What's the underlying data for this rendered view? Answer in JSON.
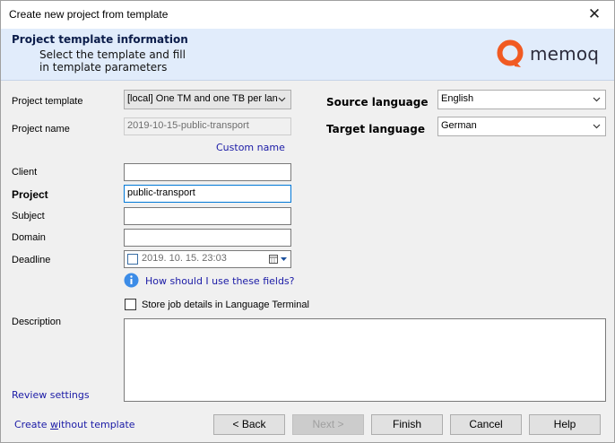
{
  "window": {
    "title": "Create new project from template"
  },
  "banner": {
    "title": "Project template information",
    "line1": "Select the template and fill",
    "line2": "in template parameters",
    "logo_text": "memoq"
  },
  "form": {
    "project_template_label": "Project template",
    "project_template_value": "[local] One TM and one TB per lan",
    "project_name_label": "Project name",
    "project_name_value": "2019-10-15-public-transport",
    "custom_name_link": "Custom name",
    "client_label": "Client",
    "client_value": "",
    "project_label": "Project",
    "project_value": "public-transport",
    "subject_label": "Subject",
    "subject_value": "",
    "domain_label": "Domain",
    "domain_value": "",
    "deadline_label": "Deadline",
    "deadline_value": "2019. 10. 15. 23:03",
    "help_link": "How should I use these fields?",
    "store_job_label": "Store job details in Language Terminal",
    "description_label": "Description",
    "review_link": "Review settings",
    "source_language_label": "Source language",
    "source_language_value": "English",
    "target_language_label": "Target language",
    "target_language_value": "German"
  },
  "footer": {
    "create_without_prefix": "Create ",
    "create_without_u": "w",
    "create_without_suffix": "ithout template",
    "back_label": "< Back",
    "next_label": "Next >",
    "finish_label": "Finish",
    "cancel_label": "Cancel",
    "help_label": "Help"
  },
  "colors": {
    "banner_bg": "#e1ecfb",
    "link": "#1a1aa6",
    "logo_orange": "#f15a22",
    "focus": "#0078d7"
  },
  "icons": {
    "close": "close-icon",
    "dropdown": "chevron-down-icon",
    "info": "info-icon",
    "calendar": "calendar-icon",
    "logo": "memoq-logo-icon"
  }
}
